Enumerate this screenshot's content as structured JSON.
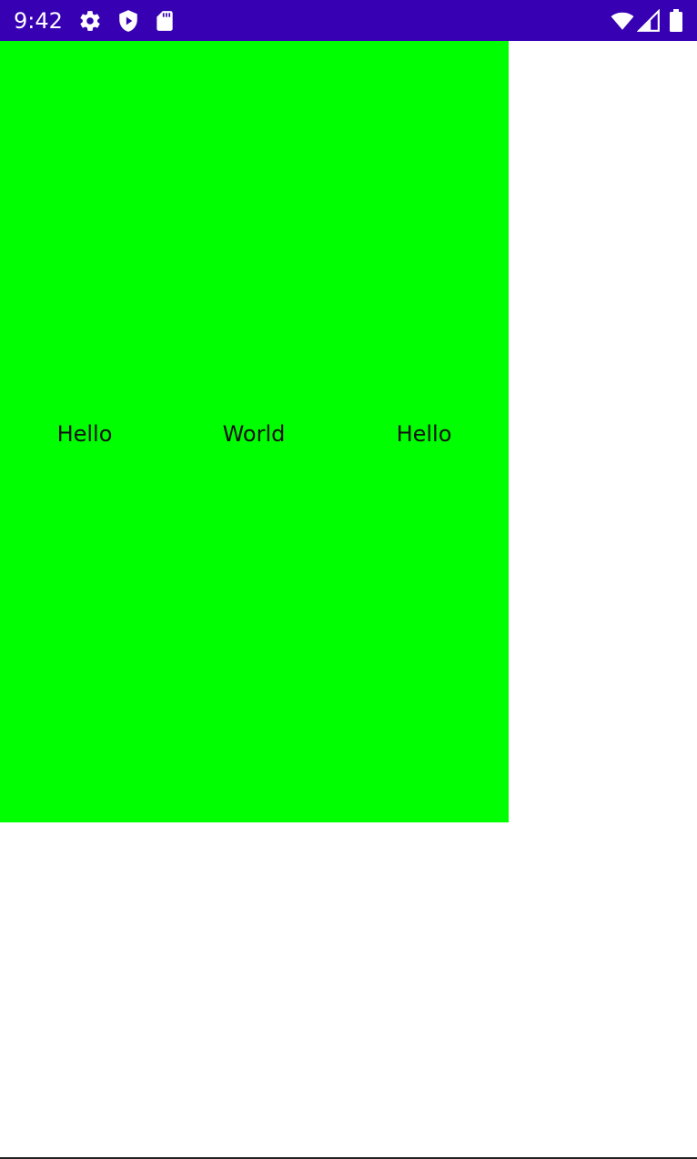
{
  "status_bar": {
    "time": "9:42",
    "background_color": "#3700b3",
    "left_icons": [
      "settings-gear-icon",
      "play-protect-icon",
      "sd-card-icon"
    ],
    "right_icons": [
      "wifi-icon",
      "cell-signal-icon",
      "battery-icon"
    ]
  },
  "content": {
    "background_color": "#00ff00",
    "labels": [
      "Hello",
      "World",
      "Hello"
    ]
  }
}
